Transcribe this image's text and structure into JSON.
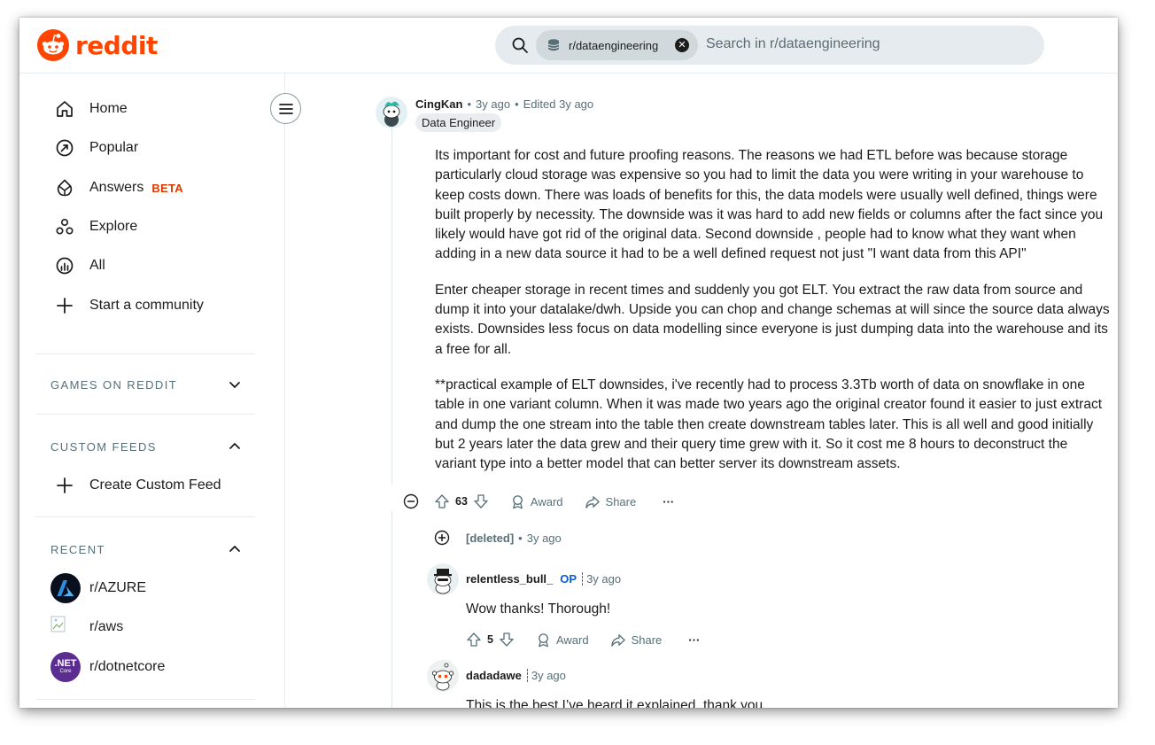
{
  "header": {
    "logo_text": "reddit",
    "search_chip": "r/dataengineering",
    "search_placeholder": "Search in r/dataengineering"
  },
  "sidebar": {
    "nav": [
      {
        "label": "Home",
        "icon": "home-icon"
      },
      {
        "label": "Popular",
        "icon": "popular-icon"
      },
      {
        "label": "Answers",
        "icon": "answers-icon",
        "badge": "BETA"
      },
      {
        "label": "Explore",
        "icon": "explore-icon"
      },
      {
        "label": "All",
        "icon": "all-icon"
      },
      {
        "label": "Start a community",
        "icon": "plus-icon"
      }
    ],
    "games_title": "GAMES ON REDDIT",
    "custom_feeds_title": "CUSTOM FEEDS",
    "create_custom_feed": "Create Custom Feed",
    "recent_title": "RECENT",
    "recent": [
      {
        "label": "r/AZURE"
      },
      {
        "label": "r/aws"
      },
      {
        "label": "r/dotnetcore",
        "avatar_text": ".NET",
        "avatar_sub": "Core"
      }
    ]
  },
  "comments": {
    "top": {
      "author": "CingKan",
      "time": "3y ago",
      "edited": "Edited 3y ago",
      "flair": "Data Engineer",
      "paragraphs": [
        "Its important for cost and future proofing reasons. The reasons we had ETL before was because storage particularly cloud storage was expensive so you had to limit the data you were writing in your warehouse to keep costs down. There was loads of benefits for this, the data models were usually well defined, things were built properly by necessity. The downside was it was hard to add new fields or columns after the fact since you likely would have got rid of the original data. Second downside , people had to know what they want when adding in a new data source it had to be a well defined request not just \"I want data from this API\"",
        "Enter cheaper storage in recent times and suddenly you got ELT. You extract the raw data from source and dump it into your datalake/dwh. Upside you can chop and change schemas at will since the source data always exists. Downsides less focus on data modelling since everyone is just dumping data into the warehouse and its a free for all.",
        "**practical example of ELT downsides, i've recently had to process 3.3Tb worth of data on snowflake in one table in one variant column. When it was made two years ago the original creator found it easier to just extract and dump the one stream into the table then create downstream tables later. This is all well and good initially but 2 years later the data grew and their query time grew with it. So it cost me 8 hours to deconstruct the variant type into a better model that can better server its downstream assets."
      ],
      "score": "63",
      "award": "Award",
      "share": "Share",
      "more": "···"
    },
    "deleted": {
      "author": "[deleted]",
      "time": "3y ago"
    },
    "reply1": {
      "author": "relentless_bull_",
      "op": "OP",
      "time": "3y ago",
      "text": "Wow thanks! Thorough!",
      "score": "5",
      "award": "Award",
      "share": "Share",
      "more": "···"
    },
    "reply2": {
      "author": "dadadawe",
      "time": "3y ago",
      "text": "This is the best I’ve heard it explained, thank you"
    }
  },
  "colors": {
    "brand": "#ff4500",
    "beta": "#d93a00",
    "op": "#0a5ad8",
    "azure": "#0078d4",
    "dotnet": "#5c2d91"
  }
}
